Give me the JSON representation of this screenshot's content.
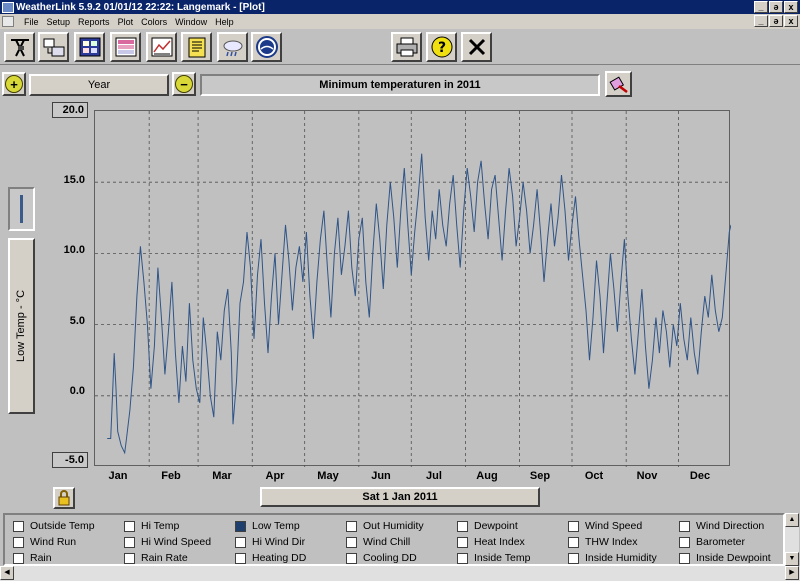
{
  "window": {
    "title": "WeatherLink 5.9.2  01/01/12  22:22: Langemark - [Plot]",
    "controls": [
      "_",
      "ə",
      "x"
    ]
  },
  "menu": {
    "items": [
      "File",
      "Setup",
      "Reports",
      "Plot",
      "Colors",
      "Window",
      "Help"
    ]
  },
  "toolbar": {
    "icons": [
      "weather-station-icon",
      "data-download-icon",
      "bulletin-icon",
      "summary-icon",
      "plot-icon",
      "notes-icon",
      "weather-cloud-icon",
      "noaa-icon"
    ],
    "right_icons": [
      "print-icon",
      "help-icon",
      "close-icon"
    ]
  },
  "controls": {
    "period": "Year",
    "plot_title": "Minimum temperaturen in 2011",
    "current_date": "Sat 1 Jan 2011"
  },
  "colors": {
    "series": "#2f5487",
    "grid": "#505050",
    "legend_checked": "#1e3f6e"
  },
  "chart_data": {
    "type": "line",
    "title": "Minimum temperaturen in 2011",
    "ylabel": "Low Temp - °C",
    "ylim": [
      -5,
      20
    ],
    "yticks": [
      "20.0",
      "15.0",
      "10.0",
      "5.0",
      "0.0",
      "-5.0"
    ],
    "xticks": [
      "Jan",
      "Feb",
      "Mar",
      "Apr",
      "May",
      "Jun",
      "Jul",
      "Aug",
      "Sep",
      "Oct",
      "Nov",
      "Dec"
    ],
    "grid": true,
    "series": [
      {
        "name": "Low Temp",
        "x_unit": "day of year 2011",
        "points": [
          [
            8,
            -3.0
          ],
          [
            10,
            -3.0
          ],
          [
            11,
            0.0
          ],
          [
            12,
            3.0
          ],
          [
            13,
            0.5
          ],
          [
            14,
            -2.5
          ],
          [
            16,
            -3.5
          ],
          [
            18,
            -4.0
          ],
          [
            19,
            -3.0
          ],
          [
            21,
            -1.0
          ],
          [
            23,
            2.0
          ],
          [
            25,
            7.0
          ],
          [
            27,
            10.5
          ],
          [
            29,
            8.0
          ],
          [
            31,
            5.0
          ],
          [
            33,
            0.5
          ],
          [
            35,
            3.5
          ],
          [
            37,
            9.0
          ],
          [
            39,
            5.5
          ],
          [
            41,
            1.5
          ],
          [
            43,
            4.5
          ],
          [
            45,
            8.0
          ],
          [
            47,
            3.0
          ],
          [
            49,
            -0.5
          ],
          [
            51,
            3.5
          ],
          [
            53,
            1.0
          ],
          [
            55,
            6.5
          ],
          [
            57,
            2.5
          ],
          [
            59,
            0.5
          ],
          [
            61,
            -0.5
          ],
          [
            63,
            5.5
          ],
          [
            65,
            3.0
          ],
          [
            67,
            0.0
          ],
          [
            69,
            -1.5
          ],
          [
            71,
            4.5
          ],
          [
            73,
            2.5
          ],
          [
            75,
            6.0
          ],
          [
            77,
            7.5
          ],
          [
            79,
            3.0
          ],
          [
            80,
            -2.0
          ],
          [
            82,
            1.0
          ],
          [
            84,
            6.5
          ],
          [
            86,
            8.0
          ],
          [
            88,
            11.5
          ],
          [
            90,
            9.0
          ],
          [
            92,
            4.0
          ],
          [
            94,
            8.5
          ],
          [
            96,
            11.0
          ],
          [
            98,
            6.5
          ],
          [
            100,
            3.0
          ],
          [
            102,
            7.0
          ],
          [
            104,
            10.0
          ],
          [
            106,
            5.0
          ],
          [
            108,
            8.5
          ],
          [
            110,
            12.0
          ],
          [
            112,
            9.5
          ],
          [
            114,
            6.0
          ],
          [
            116,
            9.0
          ],
          [
            118,
            10.5
          ],
          [
            120,
            8.0
          ],
          [
            122,
            11.5
          ],
          [
            124,
            7.0
          ],
          [
            126,
            4.0
          ],
          [
            128,
            8.0
          ],
          [
            130,
            11.0
          ],
          [
            132,
            13.0
          ],
          [
            134,
            9.0
          ],
          [
            136,
            5.5
          ],
          [
            138,
            10.0
          ],
          [
            140,
            12.5
          ],
          [
            142,
            8.5
          ],
          [
            144,
            10.5
          ],
          [
            146,
            13.0
          ],
          [
            148,
            9.0
          ],
          [
            150,
            7.0
          ],
          [
            152,
            11.0
          ],
          [
            154,
            12.5
          ],
          [
            156,
            8.0
          ],
          [
            158,
            5.5
          ],
          [
            160,
            10.0
          ],
          [
            162,
            13.5
          ],
          [
            164,
            11.0
          ],
          [
            166,
            7.5
          ],
          [
            168,
            12.0
          ],
          [
            170,
            15.0
          ],
          [
            172,
            12.5
          ],
          [
            174,
            9.0
          ],
          [
            176,
            13.0
          ],
          [
            178,
            16.0
          ],
          [
            180,
            12.0
          ],
          [
            182,
            8.5
          ],
          [
            184,
            11.5
          ],
          [
            186,
            14.0
          ],
          [
            188,
            17.0
          ],
          [
            190,
            12.5
          ],
          [
            192,
            9.5
          ],
          [
            194,
            13.0
          ],
          [
            196,
            11.0
          ],
          [
            198,
            14.5
          ],
          [
            200,
            12.0
          ],
          [
            202,
            10.5
          ],
          [
            204,
            13.5
          ],
          [
            206,
            15.5
          ],
          [
            208,
            12.0
          ],
          [
            210,
            9.0
          ],
          [
            212,
            13.0
          ],
          [
            214,
            16.0
          ],
          [
            216,
            14.0
          ],
          [
            218,
            11.5
          ],
          [
            220,
            15.0
          ],
          [
            222,
            16.5
          ],
          [
            224,
            13.5
          ],
          [
            226,
            11.0
          ],
          [
            228,
            14.5
          ],
          [
            230,
            15.5
          ],
          [
            232,
            12.5
          ],
          [
            234,
            9.5
          ],
          [
            236,
            13.0
          ],
          [
            238,
            16.0
          ],
          [
            240,
            14.0
          ],
          [
            242,
            10.5
          ],
          [
            244,
            12.5
          ],
          [
            246,
            15.0
          ],
          [
            248,
            13.0
          ],
          [
            250,
            10.0
          ],
          [
            252,
            12.0
          ],
          [
            254,
            14.5
          ],
          [
            256,
            11.5
          ],
          [
            258,
            8.0
          ],
          [
            260,
            11.0
          ],
          [
            262,
            13.5
          ],
          [
            264,
            10.5
          ],
          [
            266,
            12.5
          ],
          [
            268,
            15.5
          ],
          [
            270,
            13.0
          ],
          [
            272,
            9.5
          ],
          [
            274,
            12.0
          ],
          [
            276,
            14.0
          ],
          [
            278,
            11.0
          ],
          [
            280,
            8.5
          ],
          [
            282,
            6.0
          ],
          [
            284,
            2.5
          ],
          [
            286,
            5.5
          ],
          [
            288,
            9.5
          ],
          [
            290,
            7.0
          ],
          [
            292,
            3.0
          ],
          [
            294,
            6.5
          ],
          [
            296,
            10.0
          ],
          [
            298,
            7.5
          ],
          [
            300,
            4.5
          ],
          [
            302,
            8.0
          ],
          [
            304,
            11.0
          ],
          [
            306,
            7.0
          ],
          [
            308,
            4.0
          ],
          [
            310,
            1.5
          ],
          [
            312,
            4.5
          ],
          [
            314,
            7.5
          ],
          [
            316,
            3.5
          ],
          [
            318,
            0.5
          ],
          [
            320,
            2.5
          ],
          [
            322,
            5.5
          ],
          [
            324,
            3.0
          ],
          [
            326,
            6.0
          ],
          [
            328,
            4.5
          ],
          [
            330,
            2.0
          ],
          [
            332,
            5.0
          ],
          [
            334,
            3.5
          ],
          [
            336,
            6.5
          ],
          [
            338,
            4.0
          ],
          [
            340,
            2.5
          ],
          [
            342,
            5.5
          ],
          [
            344,
            3.0
          ],
          [
            346,
            1.5
          ],
          [
            348,
            4.5
          ],
          [
            350,
            7.0
          ],
          [
            352,
            5.5
          ],
          [
            354,
            8.5
          ],
          [
            356,
            6.0
          ],
          [
            358,
            4.5
          ],
          [
            360,
            5.5
          ],
          [
            362,
            8.5
          ],
          [
            364,
            11.5
          ],
          [
            365,
            12.0
          ]
        ]
      }
    ]
  },
  "legend": {
    "items": [
      {
        "label": "Outside Temp",
        "checked": false
      },
      {
        "label": "Hi Temp",
        "checked": false
      },
      {
        "label": "Low Temp",
        "checked": true
      },
      {
        "label": "Out Humidity",
        "checked": false
      },
      {
        "label": "Dewpoint",
        "checked": false
      },
      {
        "label": "Wind Speed",
        "checked": false
      },
      {
        "label": "Wind Direction",
        "checked": false
      },
      {
        "label": "Wind Run",
        "checked": false
      },
      {
        "label": "Hi Wind Speed",
        "checked": false
      },
      {
        "label": "Hi Wind Dir",
        "checked": false
      },
      {
        "label": "Wind Chill",
        "checked": false
      },
      {
        "label": "Heat Index",
        "checked": false
      },
      {
        "label": "THW Index",
        "checked": false
      },
      {
        "label": "Barometer",
        "checked": false
      },
      {
        "label": "Rain",
        "checked": false
      },
      {
        "label": "Rain Rate",
        "checked": false
      },
      {
        "label": "Heating DD",
        "checked": false
      },
      {
        "label": "Cooling DD",
        "checked": false
      },
      {
        "label": "Inside Temp",
        "checked": false
      },
      {
        "label": "Inside Humidity",
        "checked": false
      },
      {
        "label": "Inside Dewpoint",
        "checked": false
      }
    ]
  }
}
